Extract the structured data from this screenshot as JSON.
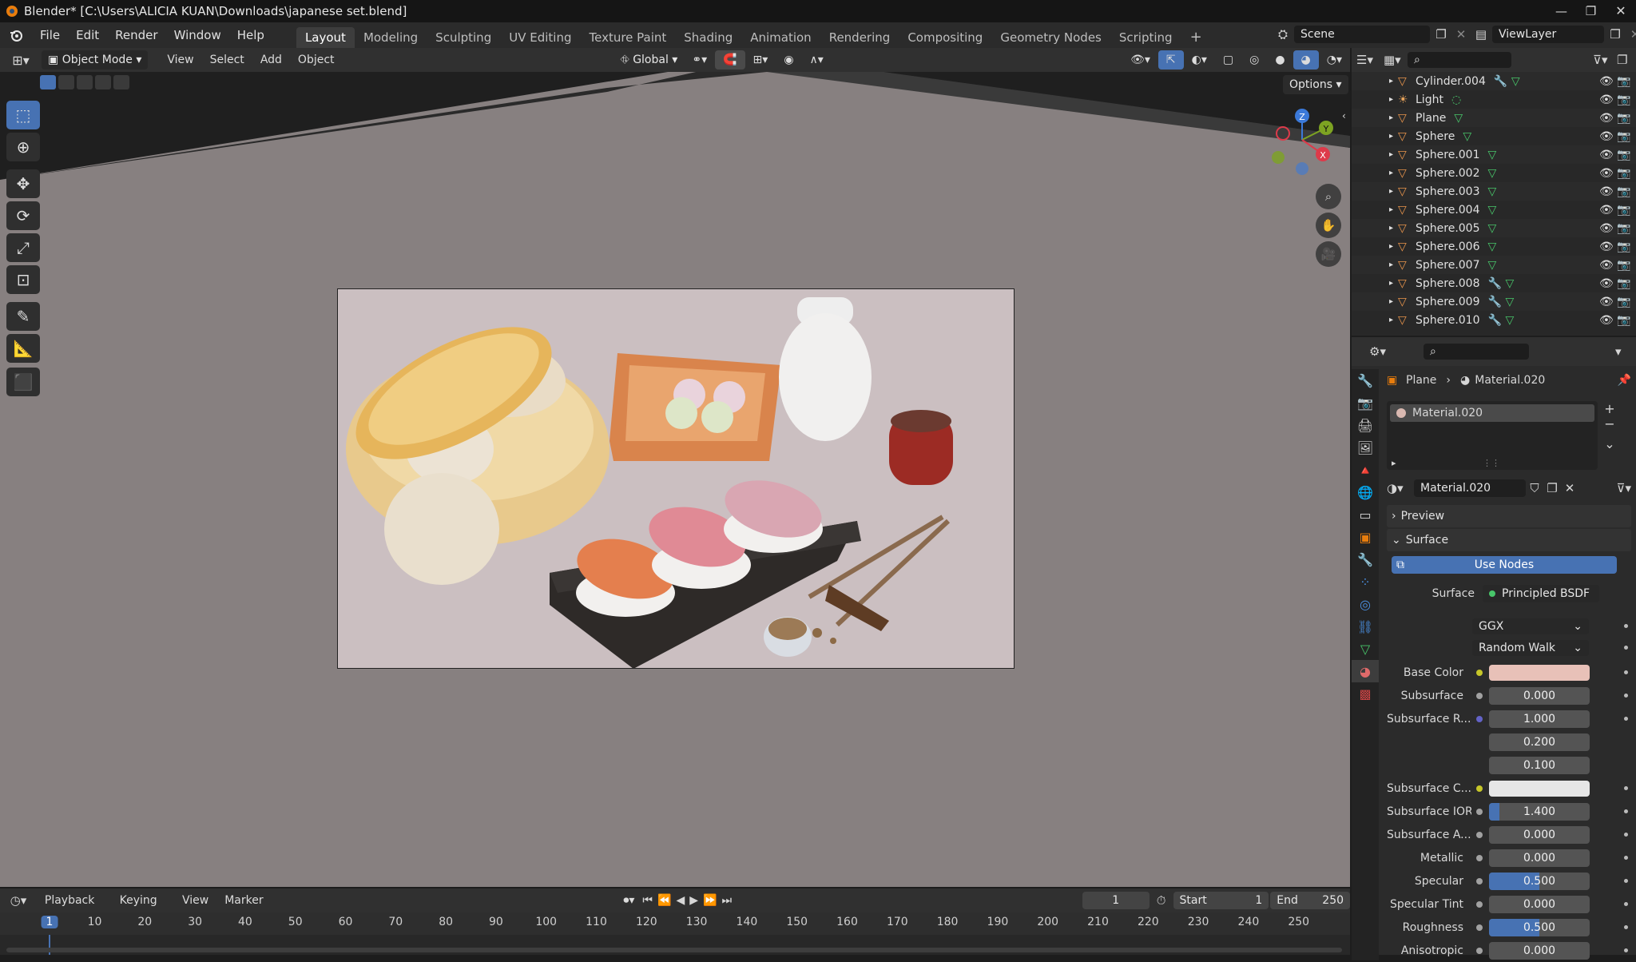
{
  "window": {
    "title": "Blender* [C:\\Users\\ALICIA KUAN\\Downloads\\japanese set.blend]",
    "min": "—",
    "max": "❐",
    "close": "✕"
  },
  "menu": [
    "File",
    "Edit",
    "Render",
    "Window",
    "Help"
  ],
  "workspaces": [
    "Layout",
    "Modeling",
    "Sculpting",
    "UV Editing",
    "Texture Paint",
    "Shading",
    "Animation",
    "Rendering",
    "Compositing",
    "Geometry Nodes",
    "Scripting"
  ],
  "active_workspace": "Layout",
  "scene": {
    "scene_name": "Scene",
    "view_layer": "ViewLayer"
  },
  "viewport": {
    "mode": "Object Mode",
    "menus": [
      "View",
      "Select",
      "Add",
      "Object"
    ],
    "transform_orientation": "Global",
    "options_label": "Options",
    "background_color": "#878080",
    "render_frame_color": "#c9bcbe"
  },
  "outliner": {
    "items": [
      {
        "name": "Cylinder.004",
        "type": "mesh",
        "modifier": true
      },
      {
        "name": "Light",
        "type": "light",
        "modifier": false
      },
      {
        "name": "Plane",
        "type": "mesh",
        "modifier": false
      },
      {
        "name": "Sphere",
        "type": "mesh",
        "modifier": false
      },
      {
        "name": "Sphere.001",
        "type": "mesh",
        "modifier": false
      },
      {
        "name": "Sphere.002",
        "type": "mesh",
        "modifier": false
      },
      {
        "name": "Sphere.003",
        "type": "mesh",
        "modifier": false
      },
      {
        "name": "Sphere.004",
        "type": "mesh",
        "modifier": false
      },
      {
        "name": "Sphere.005",
        "type": "mesh",
        "modifier": false
      },
      {
        "name": "Sphere.006",
        "type": "mesh",
        "modifier": false
      },
      {
        "name": "Sphere.007",
        "type": "mesh",
        "modifier": false
      },
      {
        "name": "Sphere.008",
        "type": "mesh",
        "modifier": true
      },
      {
        "name": "Sphere.009",
        "type": "mesh",
        "modifier": true
      },
      {
        "name": "Sphere.010",
        "type": "mesh",
        "modifier": true
      }
    ]
  },
  "properties": {
    "breadcrumb_object": "Plane",
    "breadcrumb_material": "Material.020",
    "slot_name": "Material.020",
    "material_name": "Material.020",
    "preview_label": "Preview",
    "surface_label": "Surface",
    "use_nodes_label": "Use Nodes",
    "surface_field_label": "Surface",
    "surface_shader": "Principled BSDF",
    "distribution": "GGX",
    "subsurface_method": "Random Walk",
    "base_color": "#e8c1b8",
    "subsurface_color": "#e6e6e6",
    "rows": [
      {
        "label": "Subsurface",
        "value": "0.000",
        "fraction": 0
      },
      {
        "label": "Subsurface R...",
        "value": "1.000",
        "fraction": 0
      },
      {
        "label": "",
        "value": "0.200",
        "fraction": 0
      },
      {
        "label": "",
        "value": "0.100",
        "fraction": 0
      }
    ],
    "rows2": [
      {
        "label": "Subsurface IOR",
        "value": "1.400",
        "fraction": 0.1
      },
      {
        "label": "Subsurface A...",
        "value": "0.000",
        "fraction": 0
      },
      {
        "label": "Metallic",
        "value": "0.000",
        "fraction": 0
      },
      {
        "label": "Specular",
        "value": "0.500",
        "fraction": 0.5
      },
      {
        "label": "Specular Tint",
        "value": "0.000",
        "fraction": 0
      },
      {
        "label": "Roughness",
        "value": "0.500",
        "fraction": 0.5
      },
      {
        "label": "Anisotropic",
        "value": "0.000",
        "fraction": 0
      }
    ],
    "base_color_label": "Base Color",
    "subsurface_color_label": "Subsurface C..."
  },
  "timeline": {
    "menus": [
      "Playback",
      "Keying",
      "View",
      "Marker"
    ],
    "current_frame": "1",
    "start_label": "Start",
    "start": "1",
    "end_label": "End",
    "end": "250",
    "ticks": [
      "1",
      "10",
      "20",
      "30",
      "40",
      "50",
      "60",
      "70",
      "80",
      "90",
      "100",
      "110",
      "120",
      "130",
      "140",
      "150",
      "160",
      "170",
      "180",
      "190",
      "200",
      "210",
      "220",
      "230",
      "240",
      "250"
    ]
  },
  "gizmo": {
    "x": "X",
    "y": "Y",
    "z": "Z"
  }
}
